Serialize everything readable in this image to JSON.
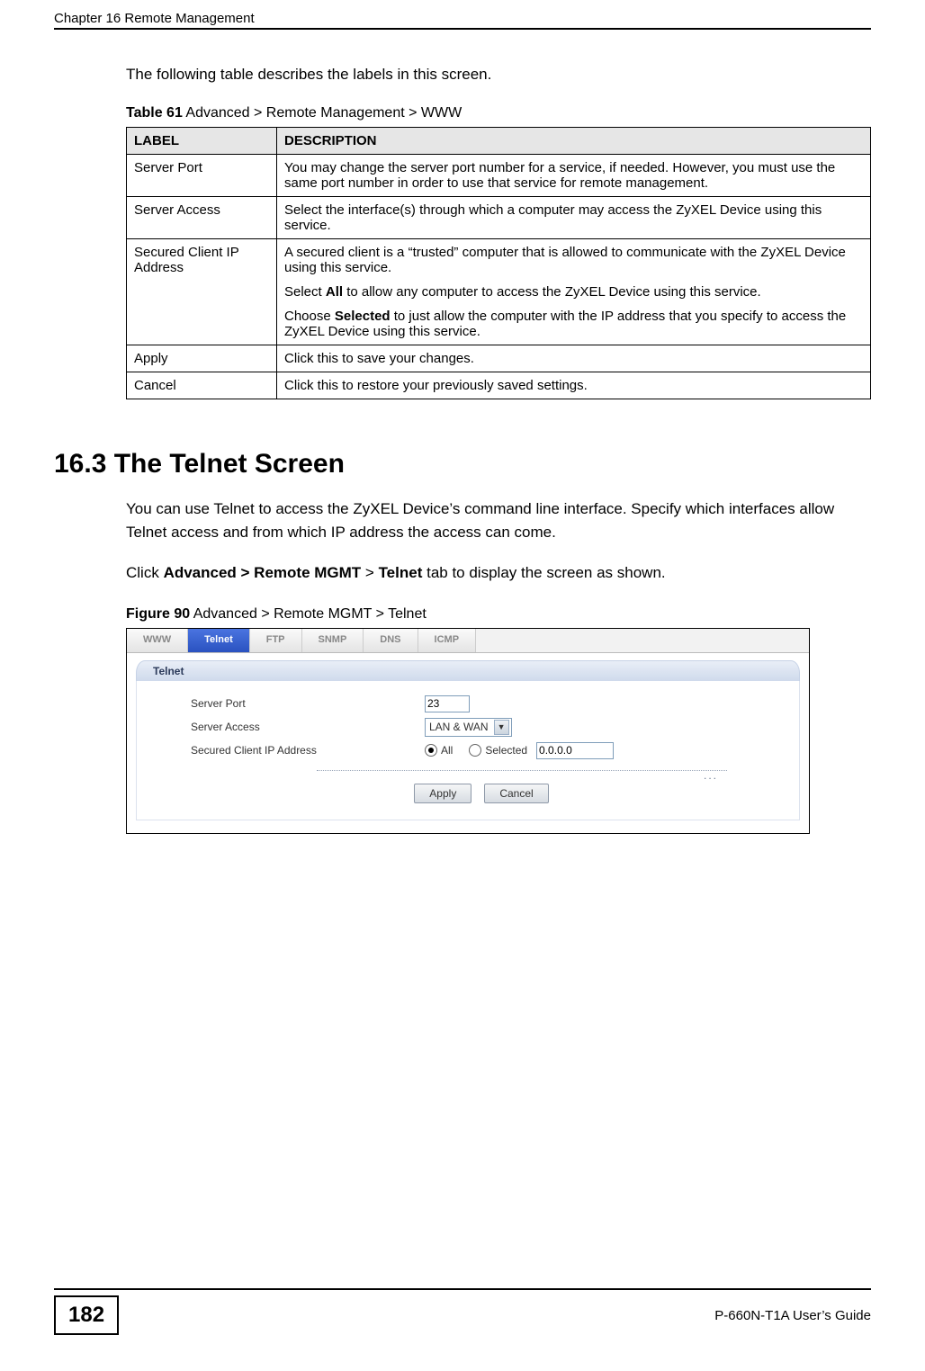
{
  "header": {
    "chapter": "Chapter 16 Remote Management"
  },
  "intro": "The following table describes the labels in this screen.",
  "table61": {
    "caption_strong": "Table 61",
    "caption_rest": "   Advanced > Remote Management > WWW",
    "head_label": "LABEL",
    "head_desc": "DESCRIPTION",
    "rows": {
      "r0": {
        "label": "Server Port",
        "desc_p1": "You may change the server port number for a service, if needed. However, you must use the same port number in order to use that service for remote management."
      },
      "r1": {
        "label": "Server Access",
        "desc_p1": "Select the interface(s) through which a computer may access the ZyXEL Device using this service."
      },
      "r2": {
        "label": "Secured Client IP Address",
        "desc_p1": "A secured client is a “trusted” computer that is allowed to communicate with the ZyXEL Device using this service.",
        "desc_p2_pre": "Select ",
        "desc_p2_b": "All",
        "desc_p2_post": " to allow any computer to access the ZyXEL Device using this service.",
        "desc_p3_pre": "Choose ",
        "desc_p3_b": "Selected",
        "desc_p3_post": " to just allow the computer with the IP address that you specify to access the ZyXEL Device using this service."
      },
      "r3": {
        "label": "Apply",
        "desc_p1": "Click this to save your changes."
      },
      "r4": {
        "label": "Cancel",
        "desc_p1": "Click this to restore your previously saved settings."
      }
    }
  },
  "section": {
    "heading": "16.3  The Telnet Screen",
    "p1": "You can use Telnet to access the ZyXEL Device’s command line interface. Specify which interfaces allow Telnet access and from which IP address the access can come.",
    "p2_pre": "Click ",
    "p2_b1": "Advanced > Remote MGMT",
    "p2_mid": " > ",
    "p2_b2": "Telnet",
    "p2_post": " tab to display the screen as shown."
  },
  "figure90": {
    "caption_strong": "Figure 90",
    "caption_rest": "   Advanced > Remote MGMT > Telnet",
    "tabs": {
      "www": "WWW",
      "telnet": "Telnet",
      "ftp": "FTP",
      "snmp": "SNMP",
      "dns": "DNS",
      "icmp": "ICMP"
    },
    "panel_title": "Telnet",
    "labels": {
      "server_port": "Server Port",
      "server_access": "Server Access",
      "secured": "Secured Client IP Address"
    },
    "values": {
      "port": "23",
      "access": "LAN & WAN",
      "radio_all": "All",
      "radio_selected": "Selected",
      "ip": "0.0.0.0"
    },
    "buttons": {
      "apply": "Apply",
      "cancel": "Cancel"
    }
  },
  "footer": {
    "page": "182",
    "guide": "P-660N-T1A User’s Guide"
  }
}
